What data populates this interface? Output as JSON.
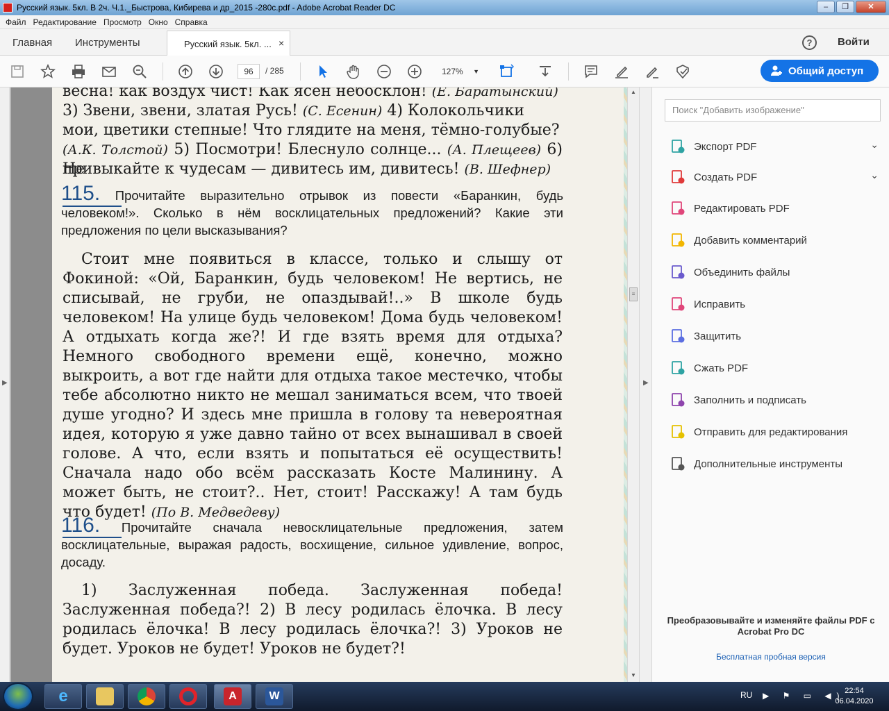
{
  "window": {
    "title": "Русский язык. 5кл. В 2ч. Ч.1._Быстрова, Кибирева и др_2015 -280с.pdf - Adobe Acrobat Reader DC",
    "min": "–",
    "max": "❐",
    "close": "✕"
  },
  "menu": [
    "Файл",
    "Редактирование",
    "Просмотр",
    "Окно",
    "Справка"
  ],
  "tabs": {
    "home": "Главная",
    "tools": "Инструменты",
    "doc": "Русский язык. 5кл. ...",
    "close": "×",
    "help": "?",
    "signin": "Войти"
  },
  "toolbar": {
    "page_current": "96",
    "page_total": "/  285",
    "zoom": "127%",
    "share": "Общий доступ"
  },
  "page": {
    "line1": "весна! как воздух чист! Как ясен небосклон!",
    "line1_attr": "(Е. Баратынский)",
    "line2a": "3) Звени, звени, златая Русь!",
    "line2_attr": "(С. Есенин)",
    "line2b": "4) Колокольчики",
    "line3": "мои, цветики степные! Что глядите на меня, тёмно-голубые?",
    "line4_attr": "(А.К. Толстой)",
    "line4b": "5) Посмотри! Блеснуло солнце...",
    "line4_attr2": "(А. Плещеев)",
    "line4c": "6) Не",
    "line5": "привыкайте к чудесам — дивитесь им, дивитесь!",
    "line5_attr": "(В. Шефнер)",
    "ex115_num": "115.",
    "ex115_task": "Прочитайте выразительно отрывок из повести «Баранкин, будь человеком!». Сколько в нём восклицательных предложений? Какие эти предложения по цели высказывания?",
    "ex115_text": "Стоит мне появиться в классе, только и слышу от Фокиной: «Ой, Баранкин, будь человеком! Не вертись, не списывай, не груби, не опаздывай!..» В школе будь человеком! На улице будь человеком! Дома будь человеком! А отдыхать когда же?! И где взять время для отдыха? Немного свободного времени ещё, конечно, можно выкроить, а вот где найти для отдыха такое местечко, чтобы тебе абсолютно никто не мешал заниматься всем, что твоей душе угодно? И здесь мне пришла в голову та невероятная идея, которую я уже давно тайно от всех вынашивал в своей голове. А что, если взять и попытаться её осуществить! Сначала надо обо всём рассказать Косте Малинину. А может быть, не стоит?.. Нет, стоит! Расскажу! А там будь что будет!",
    "ex115_attr": "(По В. Медведеву)",
    "ex116_num": "116.",
    "ex116_task": "Прочитайте сначала невосклицательные предложения, затем восклицательные, выражая радость, восхищение, сильное удивление, вопрос, досаду.",
    "ex116_text": "1) Заслуженная победа. Заслуженная победа! Заслуженная победа?! 2) В лесу родилась ёлочка. В лесу родилась ёлочка! В лесу родилась ёлочка?! 3) Уроков не будет. Уроков не будет! Уроков не будет?!"
  },
  "right_panel": {
    "search_placeholder": "Поиск \"Добавить изображение\"",
    "items": [
      {
        "label": "Экспорт PDF",
        "icon": "export-pdf-icon",
        "color": "#2ea3a3"
      },
      {
        "label": "Создать PDF",
        "icon": "create-pdf-icon",
        "color": "#e03a3a"
      },
      {
        "label": "Редактировать PDF",
        "icon": "edit-pdf-icon",
        "color": "#e0467a"
      },
      {
        "label": "Добавить комментарий",
        "icon": "comment-icon",
        "color": "#f2b600"
      },
      {
        "label": "Объединить файлы",
        "icon": "combine-files-icon",
        "color": "#6a5acd"
      },
      {
        "label": "Исправить",
        "icon": "fill-pen-icon",
        "color": "#e0467a"
      },
      {
        "label": "Защитить",
        "icon": "shield-icon",
        "color": "#5b6ee1"
      },
      {
        "label": "Сжать PDF",
        "icon": "compress-pdf-icon",
        "color": "#2ea3a3"
      },
      {
        "label": "Заполнить и подписать",
        "icon": "sign-icon",
        "color": "#8e44ad"
      },
      {
        "label": "Отправить для редактирования",
        "icon": "send-review-icon",
        "color": "#e5c100"
      },
      {
        "label": "Дополнительные инструменты",
        "icon": "more-tools-icon",
        "color": "#555555"
      }
    ],
    "promo": "Преобразовывайте и изменяйте файлы PDF с Acrobat Pro DC",
    "trial": "Бесплатная пробная версия"
  },
  "taskbar": {
    "apps": [
      "ie-icon",
      "explorer-icon",
      "chrome-icon",
      "opera-icon",
      "acrobat-icon",
      "word-icon"
    ],
    "lang": "RU",
    "tray": "▶ ⚑ ▭ ◀)",
    "time": "22:54",
    "date": "06.04.2020"
  }
}
